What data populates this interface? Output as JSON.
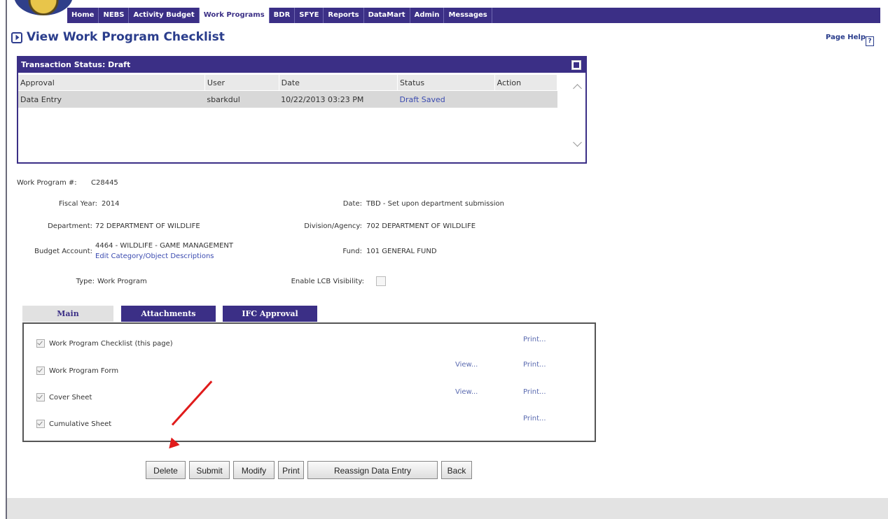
{
  "nav": {
    "tabs": [
      "Home",
      "NEBS",
      "Activity Budget",
      "Work Programs",
      "BDR",
      "SFYE",
      "Reports",
      "DataMart",
      "Admin",
      "Messages"
    ],
    "active": "Work Programs"
  },
  "page": {
    "title": "View Work Program Checklist",
    "help": "Page Help"
  },
  "transaction": {
    "header": "Transaction Status: Draft",
    "columns": [
      "Approval",
      "User",
      "Date",
      "Status",
      "Action"
    ],
    "rows": [
      {
        "approval": "Data Entry",
        "user": "sbarkdul",
        "date": "10/22/2013 03:23 PM",
        "status": "Draft Saved",
        "action": ""
      }
    ]
  },
  "details": {
    "work_program_label": "Work Program #:",
    "work_program": "C28445",
    "fiscal_year_label": "Fiscal Year:",
    "fiscal_year": "2014",
    "date_label": "Date:",
    "date": "TBD - Set upon department submission",
    "department_label": "Department:",
    "department": "72 DEPARTMENT OF WILDLIFE",
    "division_label": "Division/Agency:",
    "division": "702 DEPARTMENT OF WILDLIFE",
    "budget_account_label": "Budget Account:",
    "budget_account": "4464 - WILDLIFE - GAME MANAGEMENT",
    "edit_link": "Edit Category/Object Descriptions",
    "fund_label": "Fund:",
    "fund": "101 GENERAL FUND",
    "type_label": "Type:",
    "type": "Work Program",
    "lcb_label": "Enable LCB Visibility:"
  },
  "subtabs": [
    "Main",
    "Attachments",
    "IFC Approval"
  ],
  "checklist": {
    "items": [
      {
        "label": "Work Program Checklist (this page)",
        "view": "",
        "print": "Print..."
      },
      {
        "label": "Work Program Form",
        "view": "View...",
        "print": "Print..."
      },
      {
        "label": "Cover Sheet",
        "view": "View...",
        "print": "Print..."
      },
      {
        "label": "Cumulative Sheet",
        "view": "",
        "print": "Print..."
      }
    ]
  },
  "buttons": {
    "delete": "Delete",
    "submit": "Submit",
    "modify": "Modify",
    "print": "Print",
    "reassign": "Reassign Data Entry",
    "back": "Back"
  }
}
